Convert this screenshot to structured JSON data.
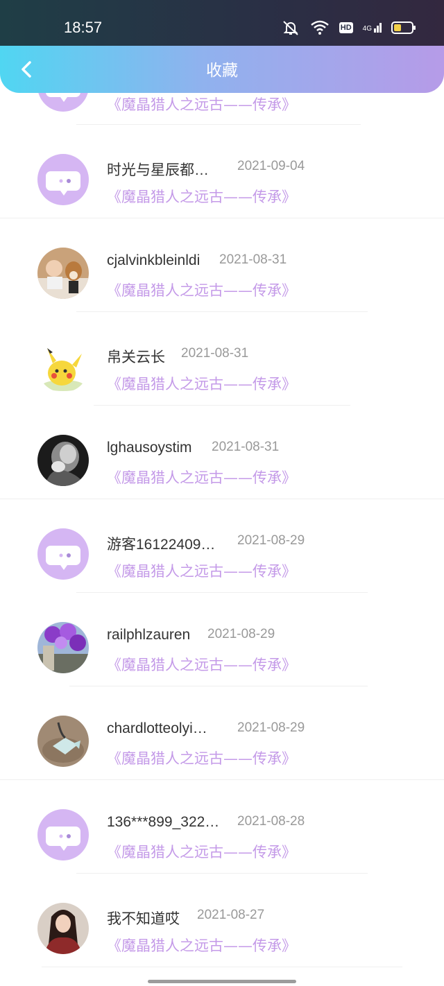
{
  "status_bar": {
    "time": "18:57",
    "hd": "HD",
    "network": "4G"
  },
  "header": {
    "title": "收藏"
  },
  "favorites": [
    {
      "name": "",
      "date": "",
      "book": "《魔晶猎人之远古——传承》",
      "avatar": "default"
    },
    {
      "name": "时光与星辰都…",
      "date": "2021-09-04",
      "book": "《魔晶猎人之远古——传承》",
      "avatar": "default"
    },
    {
      "name": "cjalvinkbleinldi",
      "date": "2021-08-31",
      "book": "《魔晶猎人之远古——传承》",
      "avatar": "photo-child-dog"
    },
    {
      "name": "帛关云长",
      "date": "2021-08-31",
      "book": "《魔晶猎人之远古——传承》",
      "avatar": "photo-pikachu"
    },
    {
      "name": "lghausoystim",
      "date": "2021-08-31",
      "book": "《魔晶猎人之远古——传承》",
      "avatar": "photo-bw-portrait"
    },
    {
      "name": "游客16122409…",
      "date": "2021-08-29",
      "book": "《魔晶猎人之远古——传承》",
      "avatar": "default"
    },
    {
      "name": "railphlzauren",
      "date": "2021-08-29",
      "book": "《魔晶猎人之远古——传承》",
      "avatar": "photo-purple-flowers"
    },
    {
      "name": "chardlotteolyi…",
      "date": "2021-08-29",
      "book": "《魔晶猎人之远古——传承》",
      "avatar": "photo-candy"
    },
    {
      "name": "136***899_322…",
      "date": "2021-08-28",
      "book": "《魔晶猎人之远古——传承》",
      "avatar": "default"
    },
    {
      "name": "我不知道哎",
      "date": "2021-08-27",
      "book": "《魔晶猎人之远古——传承》",
      "avatar": "photo-woman-red"
    }
  ],
  "colors": {
    "header_gradient_start": "#50d6f2",
    "header_gradient_end": "#b69be8",
    "book_title": "#c49ae8",
    "default_avatar": "#d5b6f3"
  }
}
